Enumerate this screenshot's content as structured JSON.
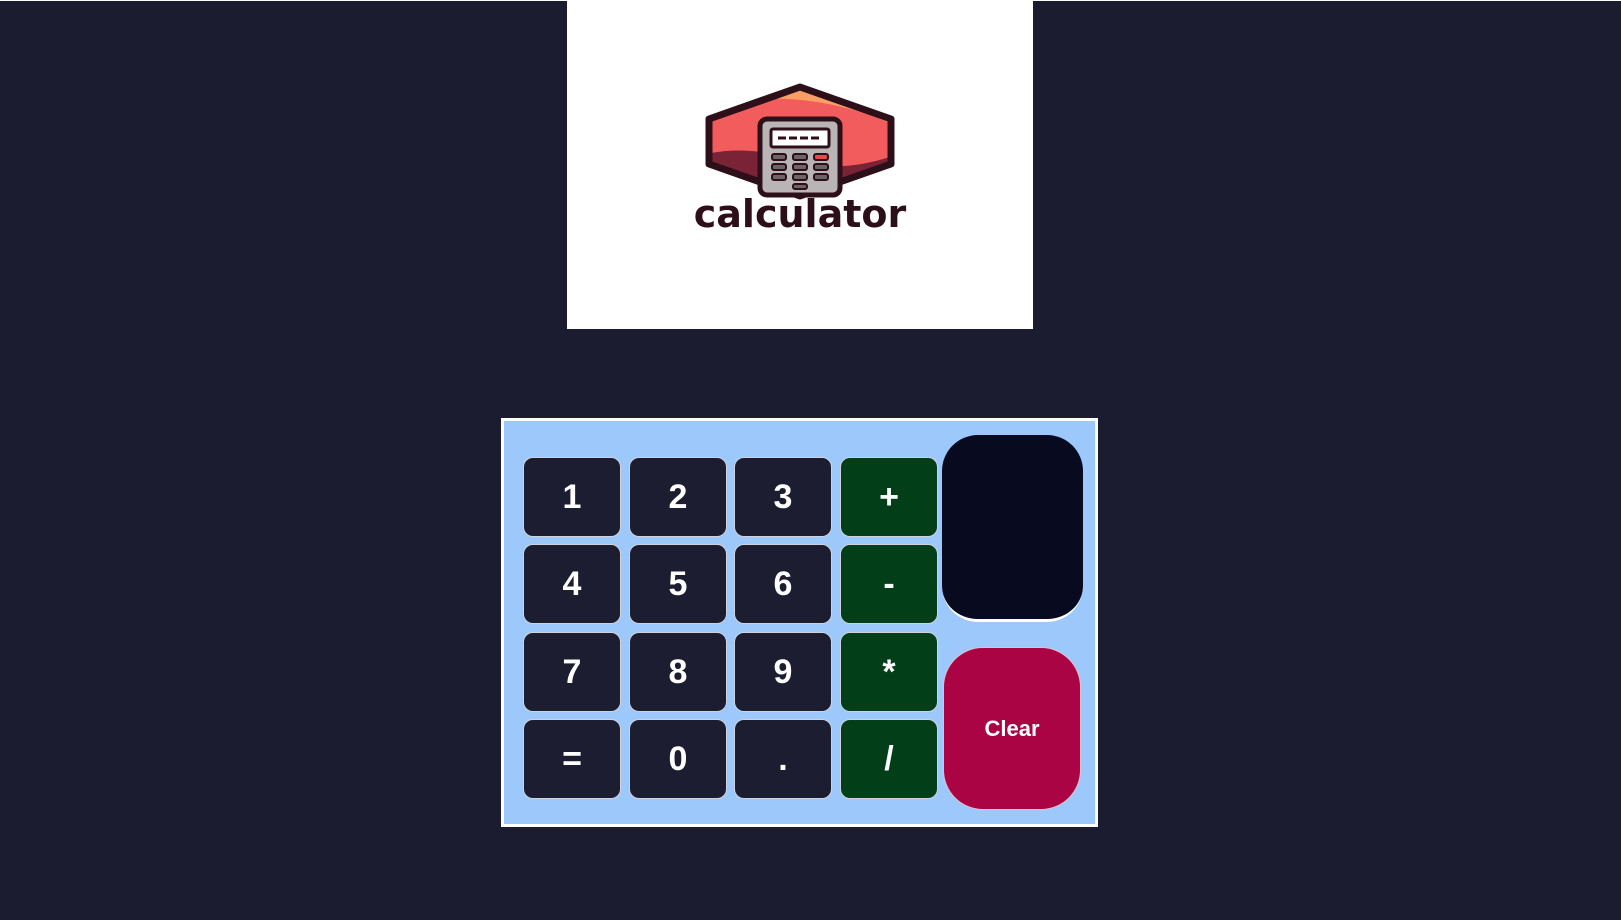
{
  "logo": {
    "wordmark": "calculator"
  },
  "calculator": {
    "display_value": "",
    "clear_label": "Clear",
    "keys": [
      {
        "label": "1",
        "kind": "digit"
      },
      {
        "label": "2",
        "kind": "digit"
      },
      {
        "label": "3",
        "kind": "digit"
      },
      {
        "label": "+",
        "kind": "operator"
      },
      {
        "label": "4",
        "kind": "digit"
      },
      {
        "label": "5",
        "kind": "digit"
      },
      {
        "label": "6",
        "kind": "digit"
      },
      {
        "label": "-",
        "kind": "operator"
      },
      {
        "label": "7",
        "kind": "digit"
      },
      {
        "label": "8",
        "kind": "digit"
      },
      {
        "label": "9",
        "kind": "digit"
      },
      {
        "label": "*",
        "kind": "operator"
      },
      {
        "label": "=",
        "kind": "equals"
      },
      {
        "label": "0",
        "kind": "digit"
      },
      {
        "label": ".",
        "kind": "decimal"
      },
      {
        "label": "/",
        "kind": "operator"
      }
    ]
  },
  "colors": {
    "page_background": "#1b1c30",
    "panel_background": "#9cc8fb",
    "key_background": "#1c1d31",
    "operator_background": "#023f19",
    "display_background": "#080a20",
    "clear_background": "#aa0445"
  }
}
